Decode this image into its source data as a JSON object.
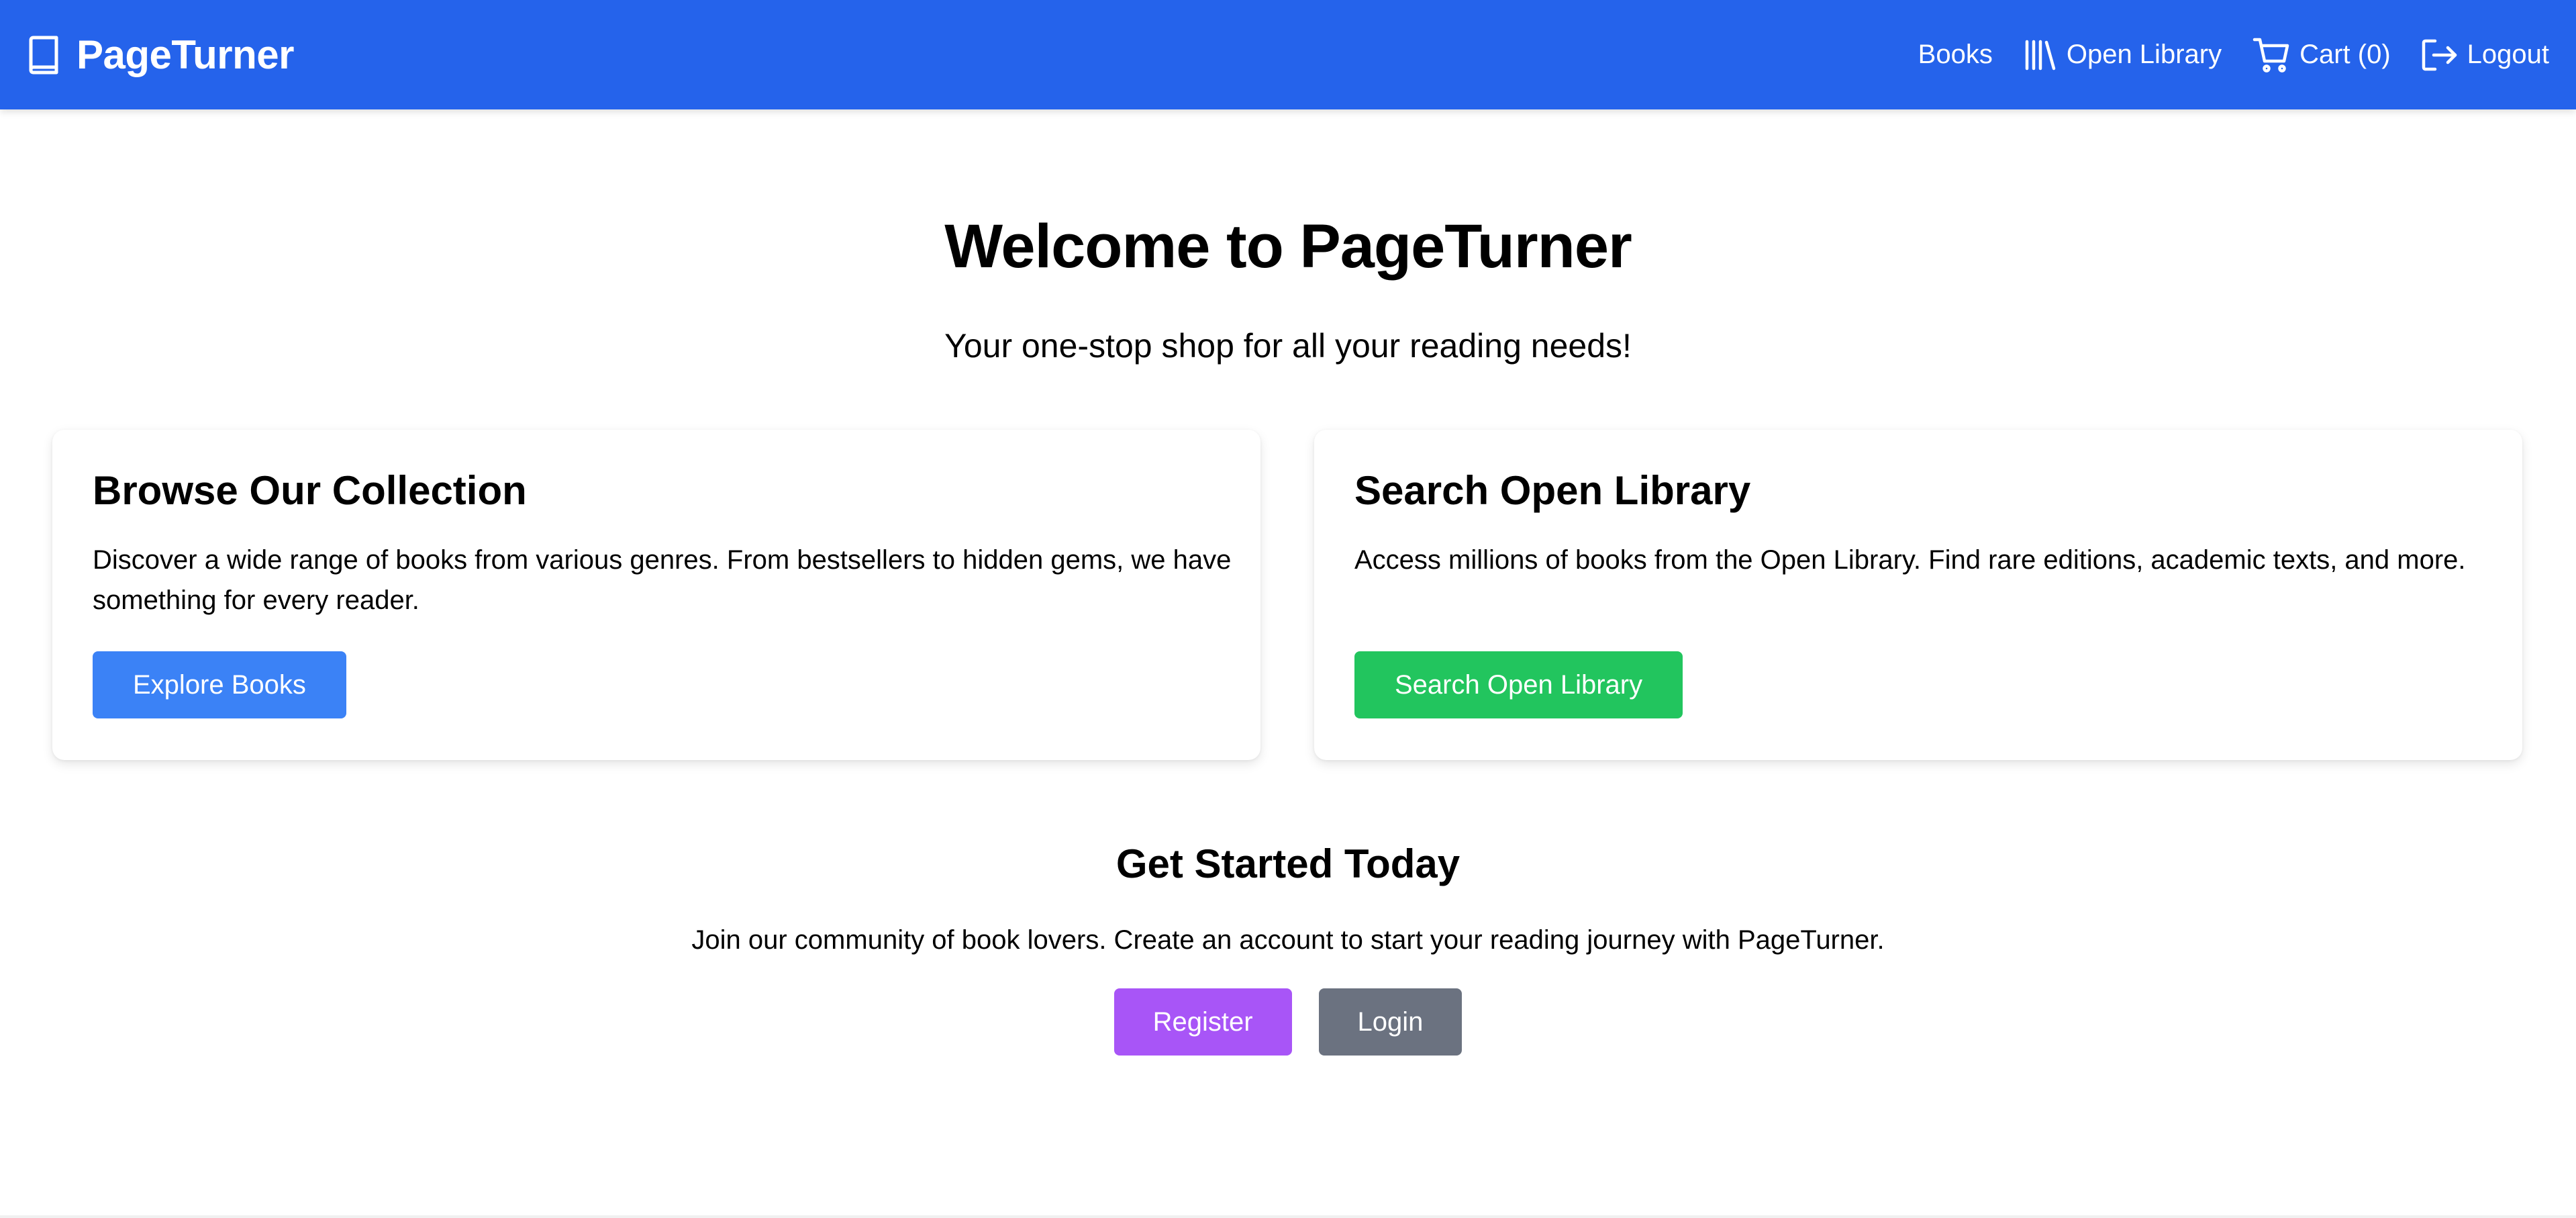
{
  "header": {
    "brand": "PageTurner",
    "nav": {
      "books": "Books",
      "open_library": "Open Library",
      "cart": "Cart (0)",
      "logout": "Logout"
    }
  },
  "hero": {
    "title": "Welcome to PageTurner",
    "subtitle": "Your one-stop shop for all your reading needs!"
  },
  "cards": {
    "browse": {
      "title": "Browse Our Collection",
      "text": "Discover a wide range of books from various genres. From bestsellers to hidden gems, we have something for every reader.",
      "button": "Explore Books"
    },
    "search": {
      "title": "Search Open Library",
      "text": "Access millions of books from the Open Library. Find rare editions, academic texts, and more.",
      "button": "Search Open Library"
    }
  },
  "get_started": {
    "title": "Get Started Today",
    "text": "Join our community of book lovers. Create an account to start your reading journey with PageTurner.",
    "register": "Register",
    "login": "Login"
  },
  "icons": {
    "brand": "book-icon",
    "open_library": "library-icon",
    "cart": "cart-icon",
    "logout": "logout-icon"
  },
  "colors": {
    "header_bg": "#2563eb",
    "explore_button": "#3b82f6",
    "search_button": "#22c55e",
    "register_button": "#a855f7",
    "login_button": "#6b7280"
  }
}
